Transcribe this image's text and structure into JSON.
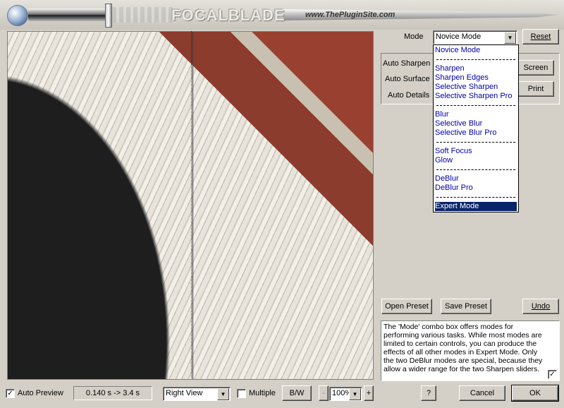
{
  "header": {
    "brand": "FOCALBLADE",
    "url": "www.ThePluginSite.com"
  },
  "mode": {
    "label": "Mode",
    "value": "Novice Mode",
    "reset_label": "Reset"
  },
  "auto": {
    "sharpen_label": "Auto Sharpen",
    "surface_label": "Auto Surface",
    "details_label": "Auto Details",
    "screen_label": "Screen",
    "print_label": "Print"
  },
  "dropdown": {
    "items": [
      {
        "label": "Novice Mode"
      },
      {
        "label": "Sharpen"
      },
      {
        "label": "Sharpen Edges"
      },
      {
        "label": "Selective Sharpen"
      },
      {
        "label": "Selective Sharpen Pro"
      },
      {
        "label": "Blur"
      },
      {
        "label": "Selective Blur"
      },
      {
        "label": "Selective Blur Pro"
      },
      {
        "label": "Soft Focus"
      },
      {
        "label": "Glow"
      },
      {
        "label": "DeBlur"
      },
      {
        "label": "DeBlur Pro"
      },
      {
        "label": "Expert Mode"
      }
    ],
    "selected": "Expert Mode"
  },
  "presets": {
    "open_label": "Open Preset",
    "save_label": "Save Preset",
    "undo_label": "Undo"
  },
  "help": {
    "text": "The 'Mode' combo box offers modes for performing various tasks. While most modes are limited to certain controls, you can produce the effects of all other modes in Expert Mode. Only the two DeBlur modes are special, because they allow a wider range for the two Sharpen sliders."
  },
  "bottom": {
    "auto_preview_label": "Auto Preview",
    "auto_preview_checked": true,
    "timing": "0.140 s -> 3.4 s",
    "view_value": "Right View",
    "multiple_label": "Multiple",
    "multiple_checked": false,
    "bw_label": "B/W",
    "zoom_minus": "-",
    "zoom_value": "100%",
    "zoom_plus": "+",
    "help_label": "?",
    "cancel_label": "Cancel",
    "ok_label": "OK"
  }
}
